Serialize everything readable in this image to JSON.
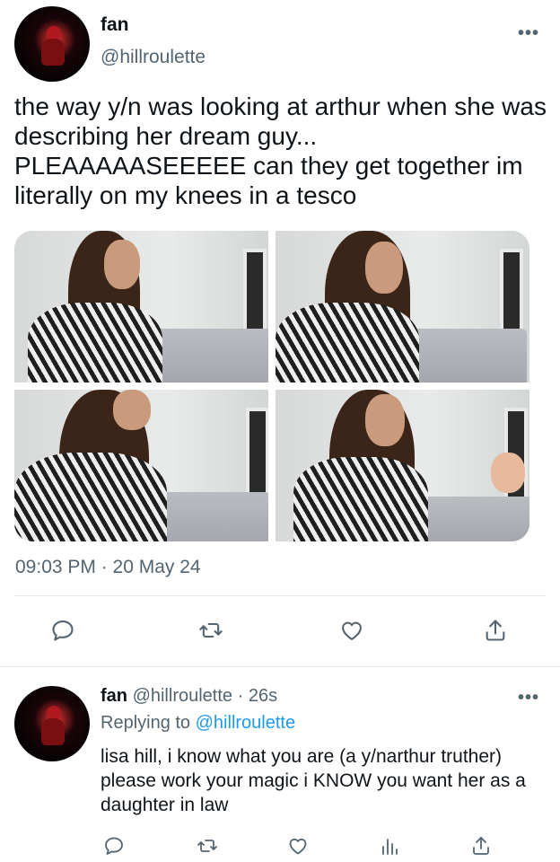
{
  "tweet": {
    "display_name": "fan",
    "handle": "@hillroulette",
    "text": "the way y/n was looking at arthur when she was describing her dream guy... PLEAAAAASEEEEE can they get together im literally on my knees in a tesco",
    "timestamp": "09:03 PM · 20 May 24",
    "more_label": "•••"
  },
  "reply": {
    "display_name": "fan",
    "handle": "@hillroulette",
    "dot": "·",
    "time": "26s",
    "replying_prefix": "Replying to",
    "replying_to": "@hillroulette",
    "text": "lisa hill, i know what you are (a y/narthur truther) please work your magic i KNOW you want her as a daughter in law",
    "more_label": "•••"
  },
  "icons": {
    "reply": "reply-icon",
    "retweet": "retweet-icon",
    "like": "heart-icon",
    "share": "share-icon",
    "analytics": "analytics-icon"
  },
  "colors": {
    "text": "#0f1419",
    "secondary": "#536471",
    "link": "#1d9bf0",
    "divider": "#e6e9ea"
  }
}
